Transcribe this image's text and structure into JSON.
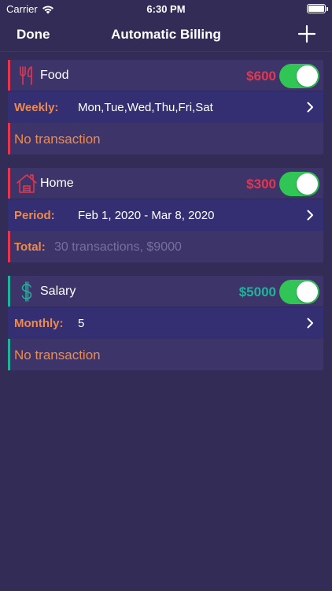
{
  "status_bar": {
    "carrier": "Carrier",
    "time": "6:30 PM"
  },
  "nav": {
    "done_label": "Done",
    "title": "Automatic Billing",
    "add_icon": "plus-icon"
  },
  "colors": {
    "background": "#322c56",
    "card": "#3d3569",
    "row": "#342f73",
    "expense_accent": "#e5364f",
    "income_accent": "#1fb39b",
    "label_orange": "#f08a4a",
    "toggle_on": "#31c556",
    "muted_text": "#76709c"
  },
  "billings": [
    {
      "name": "Food",
      "icon": "fork-knife-icon",
      "amount": "$600",
      "enabled": true,
      "schedule_label": "Weekly:",
      "schedule_value": "Mon,Tue,Wed,Thu,Fri,Sat",
      "footer_text": "No transaction"
    },
    {
      "name": "Home",
      "icon": "house-icon",
      "amount": "$300",
      "enabled": true,
      "schedule_label": "Period:",
      "schedule_value": "Feb 1, 2020 - Mar 8, 2020",
      "footer_label": "Total:",
      "footer_value": "30 transactions, $9000"
    },
    {
      "name": "Salary",
      "icon": "dollar-icon",
      "amount": "$5000",
      "enabled": true,
      "schedule_label": "Monthly:",
      "schedule_value": "5",
      "footer_text": "No transaction"
    }
  ]
}
